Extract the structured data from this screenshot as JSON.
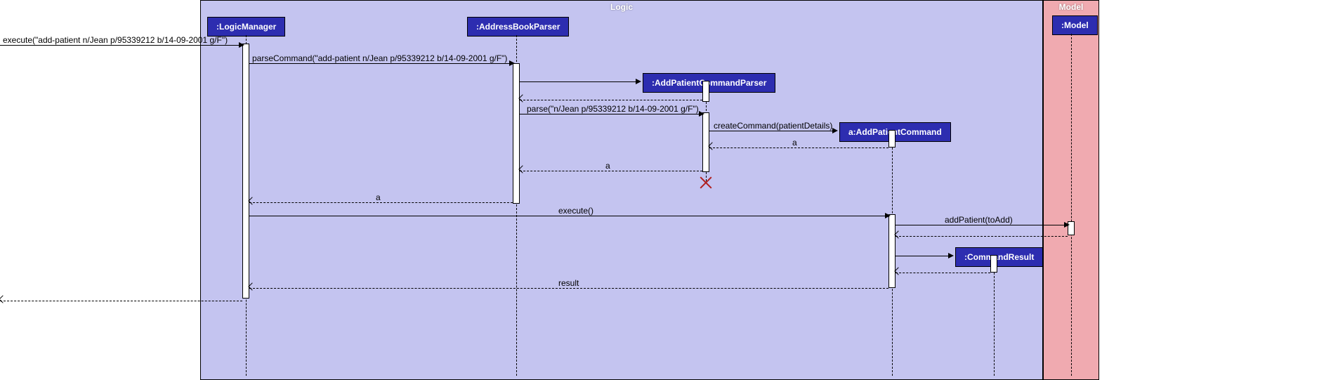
{
  "regions": {
    "logic": {
      "label": "Logic"
    },
    "model": {
      "label": "Model"
    }
  },
  "participants": {
    "logicManager": ":LogicManager",
    "addressBookParser": ":AddressBookParser",
    "addPatientCommandParser": ":AddPatientCommandParser",
    "addPatientCommand": "a:AddPatientCommand",
    "commandResult": ":CommandResult",
    "model": ":Model"
  },
  "messages": {
    "m1": "execute(\"add-patient n/Jean p/95339212 b/14-09-2001 g/F\")",
    "m2": "parseCommand(\"add-patient n/Jean p/95339212 b/14-09-2001 g/F\")",
    "m3": "parse(\"n/Jean p/95339212 b/14-09-2001 g/F\")",
    "m4": "createCommand(patientDetails)",
    "r4": "a",
    "r3": "a",
    "r2": "a",
    "m5": "execute()",
    "m6": "addPatient(toAdd)",
    "r6": "",
    "m7": "",
    "r7": "",
    "r5": "result"
  }
}
